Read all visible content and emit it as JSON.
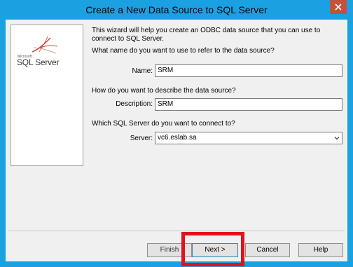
{
  "window": {
    "title": "Create a New Data Source to SQL Server"
  },
  "logo": {
    "microsoft": "Microsoft",
    "product": "SQL Server"
  },
  "intro_text": "This wizard will help you create an ODBC data source that you can use to connect to SQL Server.",
  "questions": {
    "name": "What name do you want to use to refer to the data source?",
    "description": "How do you want to describe the data source?",
    "server": "Which SQL Server do you want to connect to?"
  },
  "fields": {
    "name": {
      "label": "Name:",
      "value": "SRM"
    },
    "description": {
      "label": "Description:",
      "value": "SRM"
    },
    "server": {
      "label": "Server:",
      "value": "vc6.eslab.sa"
    }
  },
  "buttons": {
    "finish": "Finish",
    "next": "Next >",
    "cancel": "Cancel",
    "help": "Help"
  },
  "colors": {
    "titlebar": "#1ba1e2",
    "close": "#c7503d",
    "highlight": "#e3101d"
  }
}
